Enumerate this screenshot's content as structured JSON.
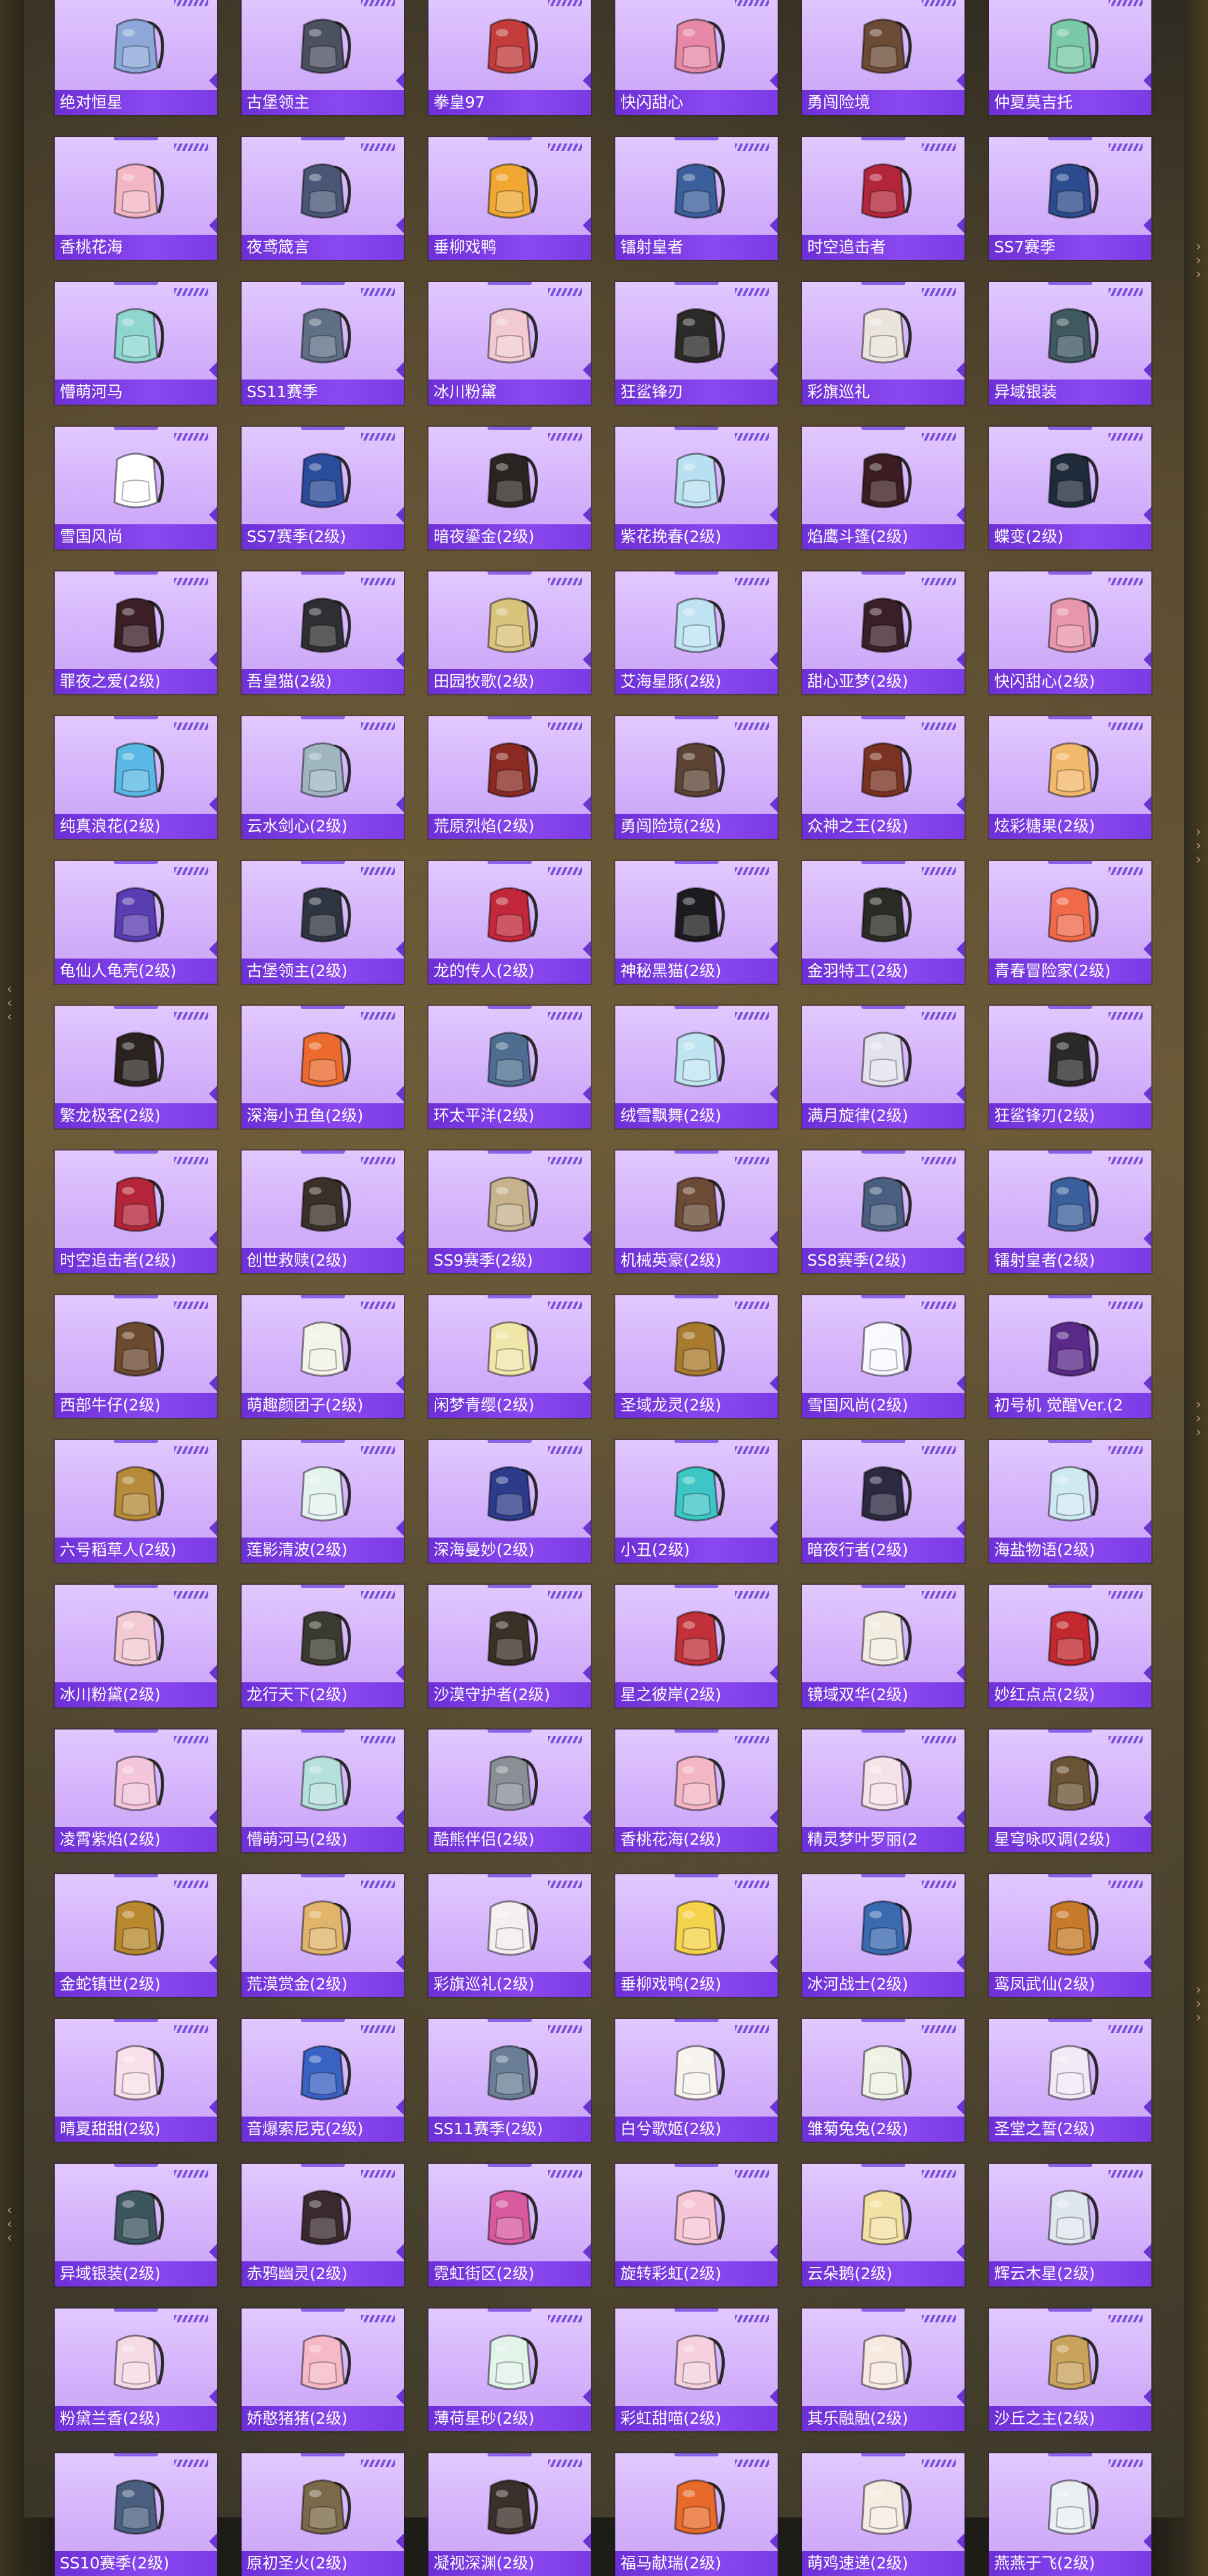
{
  "items": [
    {
      "name": "绝对恒星",
      "color": "#8ca7d8"
    },
    {
      "name": "古堡领主",
      "color": "#4b5160"
    },
    {
      "name": "拳皇97",
      "color": "#c23c3c"
    },
    {
      "name": "快闪甜心",
      "color": "#e789a6"
    },
    {
      "name": "勇闯险境",
      "color": "#6b4b36"
    },
    {
      "name": "仲夏莫吉托",
      "color": "#7ac9a8"
    },
    {
      "name": "香桃花海",
      "color": "#f2b6c4"
    },
    {
      "name": "夜鸢箴言",
      "color": "#4a5675"
    },
    {
      "name": "垂柳戏鸭",
      "color": "#f0a832"
    },
    {
      "name": "镭射皇者",
      "color": "#3b5f9c"
    },
    {
      "name": "时空追击者",
      "color": "#b3263a"
    },
    {
      "name": "SS7赛季",
      "color": "#2d4b8f"
    },
    {
      "name": "懵萌河马",
      "color": "#8fd6d0"
    },
    {
      "name": "SS11赛季",
      "color": "#5e6f86"
    },
    {
      "name": "冰川粉黛",
      "color": "#f3c9d3"
    },
    {
      "name": "狂鲨锋刃",
      "color": "#2c2a28"
    },
    {
      "name": "彩旗巡礼",
      "color": "#eae4dc"
    },
    {
      "name": "异域银装",
      "color": "#3e5960"
    },
    {
      "name": "雪国风尚",
      "color": "#ffffff"
    },
    {
      "name": "SS7赛季(2级)",
      "color": "#2b4c9a"
    },
    {
      "name": "暗夜鎏金(2级)",
      "color": "#2a2522"
    },
    {
      "name": "紫花挽春(2级)",
      "color": "#b9e0f2"
    },
    {
      "name": "焰鹰斗篷(2级)",
      "color": "#3a1c22"
    },
    {
      "name": "蝶变(2级)",
      "color": "#1f2a3a"
    },
    {
      "name": "罪夜之爱(2级)",
      "color": "#3b1e26"
    },
    {
      "name": "吾皇猫(2级)",
      "color": "#2f2f33"
    },
    {
      "name": "田园牧歌(2级)",
      "color": "#d9c27a"
    },
    {
      "name": "艾海星豚(2级)",
      "color": "#bfe3f2"
    },
    {
      "name": "甜心亚梦(2级)",
      "color": "#3a1f26"
    },
    {
      "name": "快闪甜心(2级)",
      "color": "#e896ad"
    },
    {
      "name": "纯真浪花(2级)",
      "color": "#59b8e6"
    },
    {
      "name": "云水剑心(2级)",
      "color": "#9fb6c0"
    },
    {
      "name": "荒原烈焰(2级)",
      "color": "#8a2a22"
    },
    {
      "name": "勇闯险境(2级)",
      "color": "#5d4334"
    },
    {
      "name": "众神之王(2级)",
      "color": "#7a3322"
    },
    {
      "name": "炫彩糖果(2级)",
      "color": "#f2b86b"
    },
    {
      "name": "龟仙人龟壳(2级)",
      "color": "#5a3db2"
    },
    {
      "name": "古堡领主(2级)",
      "color": "#2f3540"
    },
    {
      "name": "龙的传人(2级)",
      "color": "#c2283a"
    },
    {
      "name": "神秘黑猫(2级)",
      "color": "#1d1b1f"
    },
    {
      "name": "金羽特工(2级)",
      "color": "#2b2b25"
    },
    {
      "name": "青春冒险家(2级)",
      "color": "#f06a4a"
    },
    {
      "name": "繁龙极客(2级)",
      "color": "#2a2320"
    },
    {
      "name": "深海小丑鱼(2级)",
      "color": "#ec6a2e"
    },
    {
      "name": "环太平洋(2级)",
      "color": "#4e6d91"
    },
    {
      "name": "绒雪飘舞(2级)",
      "color": "#bfe5f2"
    },
    {
      "name": "满月旋律(2级)",
      "color": "#e4e2ec"
    },
    {
      "name": "狂鲨锋刃(2级)",
      "color": "#2a2928"
    },
    {
      "name": "时空追击者(2级)",
      "color": "#b5253a"
    },
    {
      "name": "创世救赎(2级)",
      "color": "#3a3028"
    },
    {
      "name": "SS9赛季(2级)",
      "color": "#c7b28e"
    },
    {
      "name": "机械英豪(2级)",
      "color": "#6b4a36"
    },
    {
      "name": "SS8赛季(2级)",
      "color": "#4a5f80"
    },
    {
      "name": "镭射皇者(2级)",
      "color": "#3b5f9c"
    },
    {
      "name": "西部牛仔(2级)",
      "color": "#6b4a30"
    },
    {
      "name": "萌趣颜团子(2级)",
      "color": "#f3f3ea"
    },
    {
      "name": "闲梦青缨(2级)",
      "color": "#efe6a8"
    },
    {
      "name": "圣域龙灵(2级)",
      "color": "#a87a2e"
    },
    {
      "name": "雪国风尚(2级)",
      "color": "#f8f8ff"
    },
    {
      "name": "初号机 觉醒Ver.(2",
      "color": "#5a2a8a"
    },
    {
      "name": "六号稻草人(2级)",
      "color": "#b58a3a"
    },
    {
      "name": "莲影清波(2级)",
      "color": "#e4f2f0"
    },
    {
      "name": "深海曼妙(2级)",
      "color": "#2c3b8a"
    },
    {
      "name": "小丑(2级)",
      "color": "#3ec6c6"
    },
    {
      "name": "暗夜行者(2级)",
      "color": "#2b2a40"
    },
    {
      "name": "海盐物语(2级)",
      "color": "#cfe9f3"
    },
    {
      "name": "冰川粉黛(2级)",
      "color": "#f3c9d3"
    },
    {
      "name": "龙行天下(2级)",
      "color": "#3a3a30"
    },
    {
      "name": "沙漠守护者(2级)",
      "color": "#3a3026"
    },
    {
      "name": "星之彼岸(2级)",
      "color": "#c2303a"
    },
    {
      "name": "镜域双华(2级)",
      "color": "#f2ece0"
    },
    {
      "name": "妙红点点(2级)",
      "color": "#c2282e"
    },
    {
      "name": "凌霄紫焰(2级)",
      "color": "#f3c6dc"
    },
    {
      "name": "懵萌河马(2级)",
      "color": "#b6e0dc"
    },
    {
      "name": "酷熊伴侣(2级)",
      "color": "#8a8f96"
    },
    {
      "name": "香桃花海(2级)",
      "color": "#f2b6c4"
    },
    {
      "name": "精灵梦叶罗丽(2",
      "color": "#f6e3ea"
    },
    {
      "name": "星穹咏叹调(2级)",
      "color": "#6b5436"
    },
    {
      "name": "金蛇镇世(2级)",
      "color": "#b8882e"
    },
    {
      "name": "荒漠赏金(2级)",
      "color": "#e0b46a"
    },
    {
      "name": "彩旗巡礼(2级)",
      "color": "#f3eef0"
    },
    {
      "name": "垂柳戏鸭(2级)",
      "color": "#f4d24a"
    },
    {
      "name": "冰河战士(2级)",
      "color": "#3a6ab0"
    },
    {
      "name": "鸾凤武仙(2级)",
      "color": "#c77a2a"
    },
    {
      "name": "晴夏甜甜(2级)",
      "color": "#f8e0ea"
    },
    {
      "name": "音爆索尼克(2级)",
      "color": "#3a62c2"
    },
    {
      "name": "SS11赛季(2级)",
      "color": "#6a7f96"
    },
    {
      "name": "白兮歌姬(2级)",
      "color": "#f7f3ee"
    },
    {
      "name": "雏菊兔兔(2级)",
      "color": "#eef1e4"
    },
    {
      "name": "圣堂之誓(2级)",
      "color": "#f0eaf6"
    },
    {
      "name": "异域银装(2级)",
      "color": "#3b565e"
    },
    {
      "name": "赤鸦幽灵(2级)",
      "color": "#3a2a2e"
    },
    {
      "name": "霓虹街区(2级)",
      "color": "#d85a9e"
    },
    {
      "name": "旋转彩虹(2级)",
      "color": "#f6c6d4"
    },
    {
      "name": "云朵鹅(2级)",
      "color": "#f3e1a2"
    },
    {
      "name": "辉云木星(2级)",
      "color": "#dfe7ee"
    },
    {
      "name": "粉黛兰香(2级)",
      "color": "#f6dbe6"
    },
    {
      "name": "娇憨猪猪(2级)",
      "color": "#f5b9c8"
    },
    {
      "name": "薄荷星砂(2级)",
      "color": "#e2f3ea"
    },
    {
      "name": "彩虹甜喵(2级)",
      "color": "#f7d0e0"
    },
    {
      "name": "其乐融融(2级)",
      "color": "#f7e9df"
    },
    {
      "name": "沙丘之主(2级)",
      "color": "#c9a25c"
    },
    {
      "name": "SS10赛季(2级)",
      "color": "#4a5f80"
    },
    {
      "name": "原初圣火(2级)",
      "color": "#7a6a4a"
    },
    {
      "name": "凝视深渊(2级)",
      "color": "#3a2f2a"
    },
    {
      "name": "福马献瑞(2级)",
      "color": "#e86a2a"
    },
    {
      "name": "萌鸡速递(2级)",
      "color": "#f4ece0"
    },
    {
      "name": "燕燕于飞(2级)",
      "color": "#e9eef2"
    }
  ]
}
